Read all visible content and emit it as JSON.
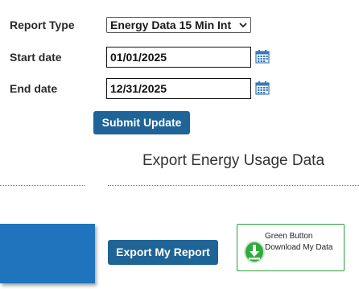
{
  "form": {
    "report_type_label": "Report Type",
    "report_type_value": "Energy Data 15 Min Int",
    "start_date_label": "Start date",
    "start_date_value": "01/01/2025",
    "end_date_label": "End date",
    "end_date_value": "12/31/2025",
    "submit_label": "Submit Update"
  },
  "export": {
    "title": "Export Energy Usage Data",
    "export_button_label": "Export My Report",
    "green_button_line1": "Green Button",
    "green_button_line2": "Download My Data"
  },
  "icons": {
    "calendar": "calendar-icon",
    "dropdown": "chevron-down-icon",
    "green_button": "green-button-download-icon"
  },
  "colors": {
    "primary_button": "#1f6496",
    "panel_blue": "#1f74bd",
    "green_button": "#2e9e3a"
  }
}
